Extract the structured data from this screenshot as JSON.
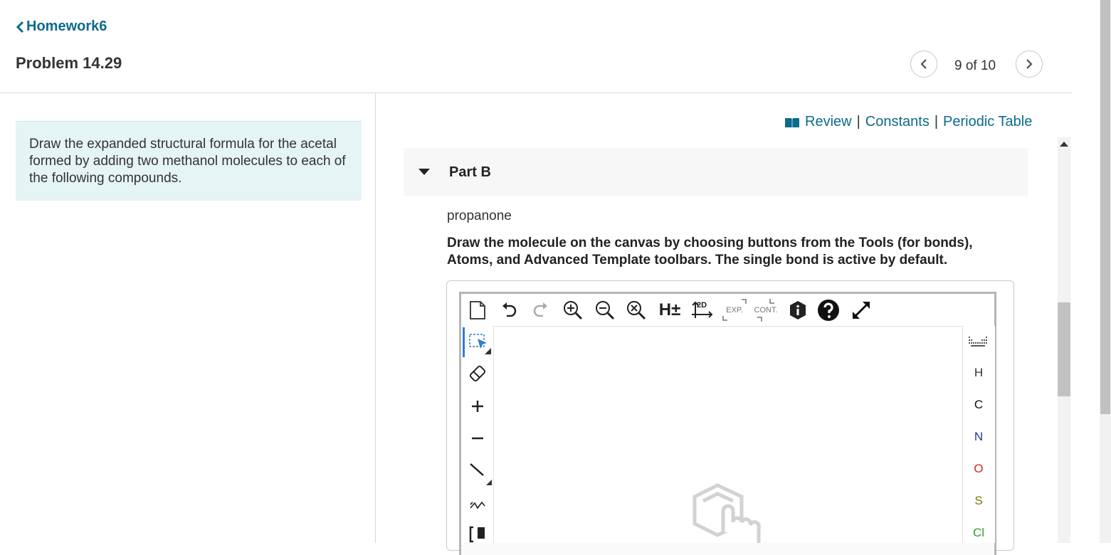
{
  "header": {
    "back_label": "Homework6",
    "problem_title": "Problem 14.29",
    "page_count": "9 of 10"
  },
  "intro": {
    "text": "Draw the expanded structural formula for the acetal formed by adding two methanol molecules to each of the following compounds."
  },
  "toplinks": {
    "review": "Review",
    "constants": "Constants",
    "periodic": "Periodic Table",
    "separator": "|"
  },
  "part": {
    "label": "Part B",
    "compound": "propanone",
    "instructions": "Draw the molecule on the canvas by choosing buttons from the Tools (for bonds), Atoms, and Advanced Template toolbars. The single bond is active by default."
  },
  "editor": {
    "top_tools": {
      "h_toggle": "H±",
      "clean2d": "2D",
      "expand": "EXP.",
      "contract": "CONT."
    },
    "atoms": [
      {
        "symbol": "H",
        "color": "#333333"
      },
      {
        "symbol": "C",
        "color": "#111111"
      },
      {
        "symbol": "N",
        "color": "#1f3a93"
      },
      {
        "symbol": "O",
        "color": "#e0251b"
      },
      {
        "symbol": "S",
        "color": "#7a7a00"
      },
      {
        "symbol": "Cl",
        "color": "#2e9e2e"
      }
    ]
  },
  "colors": {
    "link": "#0d6b8c",
    "intro_bg": "#e5f4f5",
    "select_active": "#2f7fd1"
  }
}
